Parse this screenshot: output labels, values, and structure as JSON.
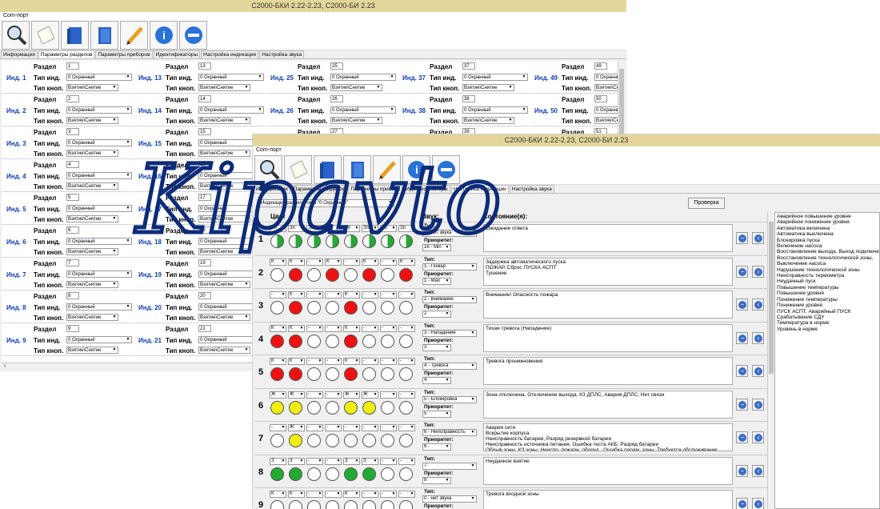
{
  "w1": {
    "title": "С2000-БКИ 2.22-2.23, С2000-БИ 2.23",
    "menu": "Com-порт",
    "tabs": [
      "Информация",
      "Параметры разделов",
      "Параметры приборов",
      "Идентификаторы",
      "Настройка индикации",
      "Настройка звука"
    ],
    "labels": {
      "razdel": "Раздел",
      "tip_ind": "Тип инд.",
      "tip_knop": "Тип кноп.",
      "ohr": "0 Охранный",
      "vzyat": "Взятие\\Снятие",
      "ohr_short": "0 Охранный",
      "vzyat_short": "Взятие\\Снятие"
    },
    "columns": [
      {
        "items": [
          {
            "n": "Инд. 1",
            "r": "1"
          },
          {
            "n": "Инд. 2",
            "r": "2"
          },
          {
            "n": "Инд. 3",
            "r": "3"
          },
          {
            "n": "Инд. 4",
            "r": "4"
          },
          {
            "n": "Инд. 5",
            "r": "5"
          },
          {
            "n": "Инд. 6",
            "r": "6"
          },
          {
            "n": "Инд. 7",
            "r": "7"
          },
          {
            "n": "Инд. 8",
            "r": "8"
          },
          {
            "n": "Инд. 9",
            "r": "9"
          }
        ]
      },
      {
        "items": [
          {
            "n": "Инд. 13",
            "r": "13"
          },
          {
            "n": "Инд. 14",
            "r": "14"
          },
          {
            "n": "Инд. 15",
            "r": "15"
          },
          {
            "n": "Инд. 16",
            "r": "16"
          },
          {
            "n": "Инд. 17",
            "r": "17"
          },
          {
            "n": "Инд. 18",
            "r": "18"
          },
          {
            "n": "Инд. 19",
            "r": "19"
          },
          {
            "n": "Инд. 20",
            "r": "20"
          },
          {
            "n": "Инд. 21",
            "r": "21"
          }
        ]
      },
      {
        "items": [
          {
            "n": "Инд. 25",
            "r": "25"
          },
          {
            "n": "Инд. 26",
            "r": "26"
          },
          {
            "n": "",
            "r": "27"
          }
        ]
      },
      {
        "items": [
          {
            "n": "Инд. 37",
            "r": "37"
          },
          {
            "n": "Инд. 38",
            "r": "38"
          },
          {
            "n": "",
            "r": "39"
          }
        ]
      },
      {
        "items": [
          {
            "n": "Инд. 49",
            "r": "49"
          },
          {
            "n": "Инд. 50",
            "r": "50"
          },
          {
            "n": "",
            "r": "51"
          }
        ]
      }
    ]
  },
  "w2": {
    "title": "С2000-БКИ 2.22-2.23, С2000-БИ 2.23",
    "menu": "Com-порт",
    "tabs": [
      "Информация",
      "Параметры разделов",
      "Параметры прибора",
      "Идентификаторы",
      "Настройка индикации",
      "Настройка звука"
    ],
    "top_select": "Индикация раздела типа \"0 Охранный\"",
    "check_btn": "Проверка",
    "headers": {
      "color": "Цвет",
      "sound": "Звук:",
      "state": "Состояние(я):"
    },
    "type_label": "Тип:",
    "prio_label": "Приоритет:",
    "rows": [
      {
        "num": "1",
        "minis": [
          "Зп",
          "Зп",
          "Зп",
          "Зп",
          "Зп",
          "Зп",
          "Зп",
          "Зп"
        ],
        "leds": [
          "gh",
          "gh",
          "gh",
          "gh",
          "gh",
          "gh",
          "gh",
          "gh"
        ],
        "type": "0 - нет звука",
        "prio": "16 - Min",
        "state": "Ожидание ответа"
      },
      {
        "num": "2",
        "minis": [
          "К",
          "К",
          "-",
          "К",
          "-",
          "К",
          "-",
          "К"
        ],
        "leds": [
          "e",
          "r",
          "e",
          "r",
          "e",
          "r",
          "e",
          "r"
        ],
        "type": "1 - Пожар",
        "prio": "1 - Max",
        "state": "Задержка автоматического пуска\nПОЖАР, Сброс ПУСКА АСПТ\nТушение"
      },
      {
        "num": "3",
        "minis": [
          "-",
          "К",
          "-",
          "-",
          "К",
          "-",
          "-",
          "-"
        ],
        "leds": [
          "e",
          "r",
          "e",
          "e",
          "r",
          "e",
          "e",
          "e"
        ],
        "type": "2 - Внимание",
        "prio": "2",
        "state": "Внимание! Опасность пожара"
      },
      {
        "num": "4",
        "minis": [
          "К",
          "К",
          "-",
          "-",
          "К",
          "-",
          "-",
          "-"
        ],
        "leds": [
          "r",
          "r",
          "e",
          "e",
          "r",
          "e",
          "e",
          "e"
        ],
        "type": "3 - Нападение",
        "prio": "3",
        "state": "Тихая тревога (Нападение)"
      },
      {
        "num": "5",
        "minis": [
          "К",
          "К",
          "-",
          "-",
          "К",
          "-",
          "-",
          "-"
        ],
        "leds": [
          "r",
          "r",
          "e",
          "e",
          "r",
          "e",
          "e",
          "e"
        ],
        "type": "4 - Тревога",
        "prio": "4",
        "state": "Тревога проникновения"
      },
      {
        "num": "6",
        "minis": [
          "Ж",
          "Ж",
          "-",
          "-",
          "Ж",
          "Ж",
          "-",
          "-"
        ],
        "leds": [
          "y",
          "y",
          "e",
          "e",
          "y",
          "y",
          "e",
          "e"
        ],
        "type": "5 - Блокировка",
        "prio": "5",
        "state": "Зона отключена, Отключение выхода, КЗ ДПЛС, Авария ДПЛС, Нет связи"
      },
      {
        "num": "7",
        "minis": [
          "-",
          "Ж",
          "-",
          "-",
          "-",
          "-",
          "-",
          "-"
        ],
        "leds": [
          "e",
          "y",
          "e",
          "e",
          "e",
          "e",
          "e",
          "e"
        ],
        "type": "6 - Неисправность",
        "prio": "6",
        "state": "Авария сети\nВскрытие корпуса\nНеисправность батареи, Разряд резервной батареи\nНеисправность источника питания, Ошибка теста АКБ, Разряд батареи\nОбрыв зоны, КЗ зоны, Неиспр. пожарн. оборуд., Ошибка парам. зоны, Требуется обслуживание"
      },
      {
        "num": "8",
        "minis": [
          "З",
          "З",
          "-",
          "-",
          "З",
          "З",
          "-",
          "-"
        ],
        "leds": [
          "g",
          "g",
          "e",
          "e",
          "g",
          "g",
          "e",
          "e"
        ],
        "type": "7",
        "prio": "8",
        "state": "Неудачное взятие"
      },
      {
        "num": "9",
        "minis": [
          "К",
          "К",
          "-",
          "-",
          "К",
          "-",
          "-",
          "-"
        ],
        "leds": [
          "e",
          "e",
          "e",
          "e",
          "e",
          "e",
          "e",
          "e"
        ],
        "type": "0 - нет звука",
        "prio": "",
        "state": "Тревога входной зоны"
      }
    ],
    "events": [
      "Аварийное повышение уровня",
      "Аварийное понижение уровня",
      "Автоматика включена",
      "Автоматика выключена",
      "Блокировка пуска",
      "Включение насоса",
      "Восстановление выхода, Выход подключен",
      "Восстановление технологической зоны,",
      "Выключение насоса",
      "Нарушение технологической зоны",
      "Неисправность термометра",
      "Неудачный пуск",
      "Повышение температуры",
      "Повышение уровня",
      "Понижение температуры",
      "Понижение уровня",
      "ПУСК АСПТ, Аварийный ПУСК",
      "Срабатывание СДУ",
      "Температура в норме",
      "Уровень в норме"
    ]
  },
  "watermark": "Kipavto",
  "colors": {
    "title": "#e4d69b",
    "blue": "#1040b0",
    "red": "#ee1111",
    "green": "#22aa33",
    "yellow": "#f2ee10",
    "watermark": "#0c2c78"
  }
}
